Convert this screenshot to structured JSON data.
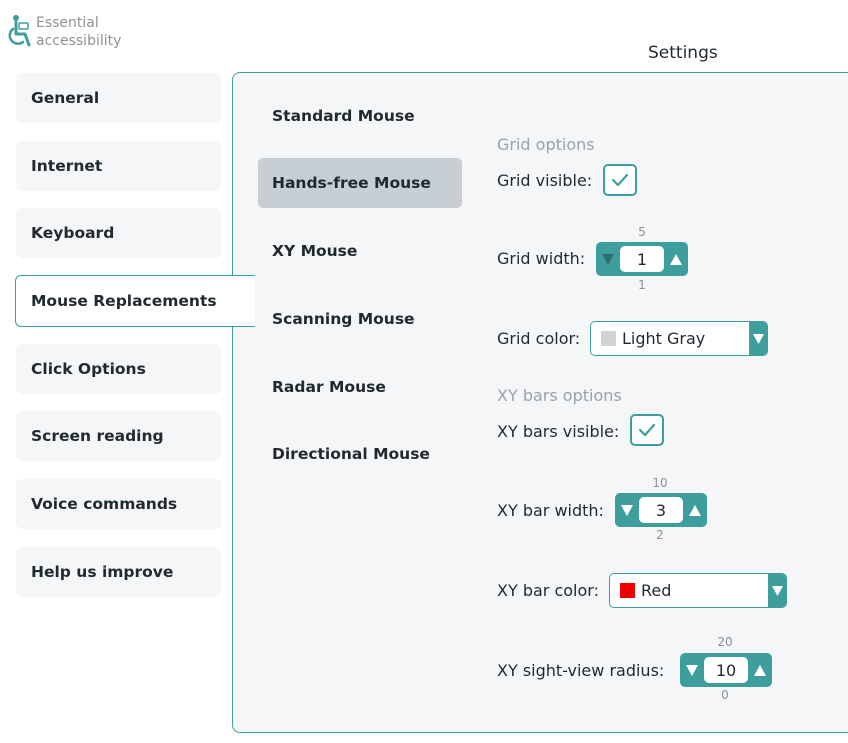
{
  "app": {
    "name_line1": "Essential",
    "name_line2": "accessibility",
    "page_title": "Settings"
  },
  "sidebar": {
    "items": [
      {
        "label": "General",
        "active": false
      },
      {
        "label": "Internet",
        "active": false
      },
      {
        "label": "Keyboard",
        "active": false
      },
      {
        "label": "Mouse Replacements",
        "active": true
      },
      {
        "label": "Click Options",
        "active": false
      },
      {
        "label": "Screen reading",
        "active": false
      },
      {
        "label": "Voice commands",
        "active": false
      },
      {
        "label": "Help us improve",
        "active": false
      }
    ]
  },
  "submenu": {
    "items": [
      {
        "label": "Standard Mouse",
        "active": false
      },
      {
        "label": "Hands-free Mouse",
        "active": true
      },
      {
        "label": "XY Mouse",
        "active": false
      },
      {
        "label": "Scanning Mouse",
        "active": false
      },
      {
        "label": "Radar Mouse",
        "active": false
      },
      {
        "label": "Directional Mouse",
        "active": false
      }
    ]
  },
  "grid": {
    "section_label": "Grid options",
    "visible_label": "Grid visible:",
    "visible": true,
    "width_label": "Grid width:",
    "width_value": "1",
    "width_max": "5",
    "width_min": "1",
    "color_label": "Grid color:",
    "color_value": "Light Gray",
    "color_swatch": "#d3d3d3"
  },
  "xybars": {
    "section_label": "XY bars options",
    "visible_label": "XY bars visible:",
    "visible": true,
    "width_label": "XY bar width:",
    "width_value": "3",
    "width_max": "10",
    "width_min": "2",
    "color_label": "XY bar color:",
    "color_value": "Red",
    "color_swatch": "#ee0000",
    "radius_label": "XY sight-view radius:",
    "radius_value": "10",
    "radius_max": "20",
    "radius_min": "0"
  },
  "colors": {
    "accent": "#3d9e9d",
    "panel_bg": "#f4f6f8",
    "active_sub_bg": "#c7ced4",
    "muted_text": "#9aa3a9"
  }
}
